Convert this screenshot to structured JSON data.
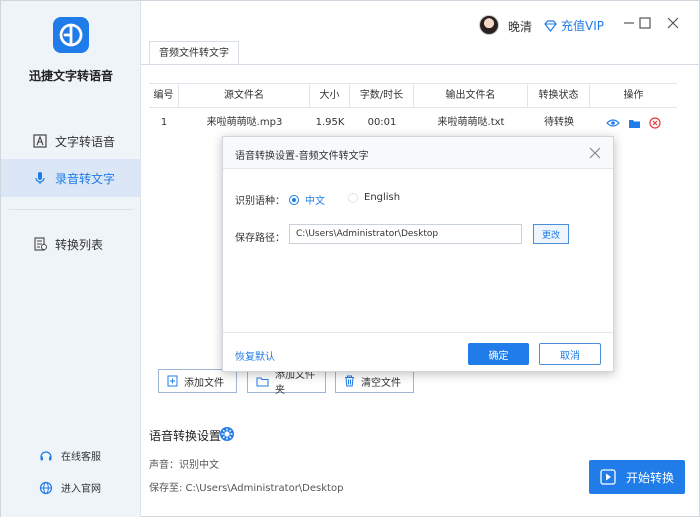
{
  "app": {
    "name": "迅捷文字转语音",
    "accent_color": "#1f7ce8"
  },
  "sidebar": {
    "items": [
      {
        "label": "文字转语音",
        "icon": "text-to-speech-icon",
        "active": false
      },
      {
        "label": "录音转文字",
        "icon": "microphone-icon",
        "active": true
      },
      {
        "label": "转换列表",
        "icon": "conversion-list-icon",
        "active": false
      }
    ],
    "bottom_links": [
      {
        "label": "在线客服",
        "icon": "headset-icon"
      },
      {
        "label": "进入官网",
        "icon": "globe-icon"
      }
    ]
  },
  "header": {
    "username": "晚清",
    "vip_label": "充值VIP"
  },
  "tabs": [
    {
      "label": "音频文件转文字",
      "active": true
    }
  ],
  "table": {
    "headers": [
      "编号",
      "源文件名",
      "大小",
      "字数/时长",
      "输出文件名",
      "转换状态",
      "操作"
    ],
    "rows": [
      {
        "index": "1",
        "source": "来啦萌萌哒.mp3",
        "size": "1.95K",
        "duration": "00:01",
        "output": "来啦萌萌哒.txt",
        "status": "待转换"
      }
    ]
  },
  "toolbar": {
    "add_file": "添加文件",
    "add_folder": "添加文件夹",
    "clear_files": "清空文件"
  },
  "settings": {
    "title": "语音转换设置",
    "voice_line": "声音：识别中文",
    "save_line": "保存至: C:\\Users\\Administrator\\Desktop"
  },
  "start_button": "开始转换",
  "modal": {
    "title": "语音转换设置-音频文件转文字",
    "language_label": "识别语种：",
    "lang_options": [
      "中文",
      "English"
    ],
    "selected_lang": "中文",
    "path_label": "保存路径：",
    "path_value": "C:\\Users\\Administrator\\Desktop",
    "change_button": "更改",
    "restore_default": "恢复默认",
    "ok_button": "确定",
    "cancel_button": "取消"
  }
}
